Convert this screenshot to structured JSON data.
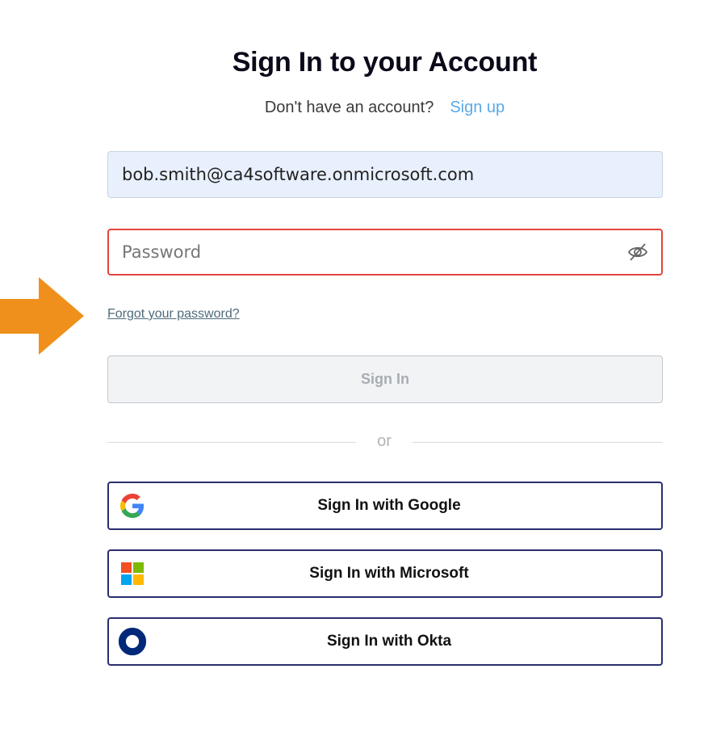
{
  "header": {
    "title": "Sign In to your Account",
    "prompt": "Don't have an account?",
    "signup_link": "Sign up"
  },
  "form": {
    "email_value": "bob.smith@ca4software.onmicrosoft.com",
    "password_placeholder": "Password",
    "password_value": "",
    "forgot_link": "Forgot your password?",
    "signin_label": "Sign In",
    "divider_text": "or"
  },
  "sso": {
    "google_label": "Sign In with Google",
    "microsoft_label": "Sign In with Microsoft",
    "okta_label": "Sign In with Okta"
  },
  "icons": {
    "eye": "eye-slash-icon",
    "google": "google-logo-icon",
    "microsoft": "microsoft-logo-icon",
    "okta": "okta-logo-icon",
    "annotation": "orange-arrow-icon"
  },
  "colors": {
    "link": "#5aa9e6",
    "error_border": "#e0463c",
    "email_bg": "#e8f0fe",
    "sso_border": "#2a2e6e",
    "arrow": "#f0901c",
    "okta": "#00297a"
  }
}
